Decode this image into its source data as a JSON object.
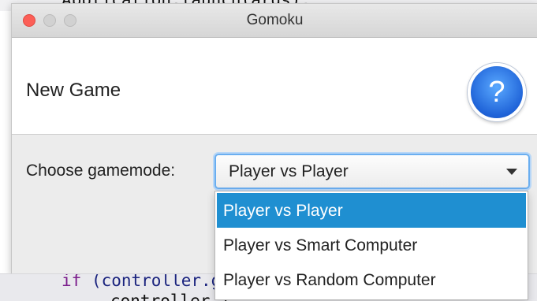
{
  "editor": {
    "top_line": "Application.launch(args);",
    "bottom_line1_kw": "if",
    "bottom_line1_rest": "(controller.g",
    "bottom_line2": "controller.j"
  },
  "window": {
    "title": "Gomoku"
  },
  "dialog": {
    "header": "New Game",
    "help_glyph": "?",
    "gamemode_label": "Choose gamemode:",
    "gamemode_selected": "Player vs Player"
  },
  "dropdown": {
    "options": [
      {
        "label": "Player vs Player",
        "selected": true
      },
      {
        "label": "Player vs Smart Computer",
        "selected": false
      },
      {
        "label": "Player vs Random Computer",
        "selected": false
      }
    ]
  },
  "colors": {
    "close_button": "#fc5f57",
    "selection": "#1f8fd1",
    "help_button": "#1f63d8",
    "focus_ring": "#6aaef0"
  }
}
